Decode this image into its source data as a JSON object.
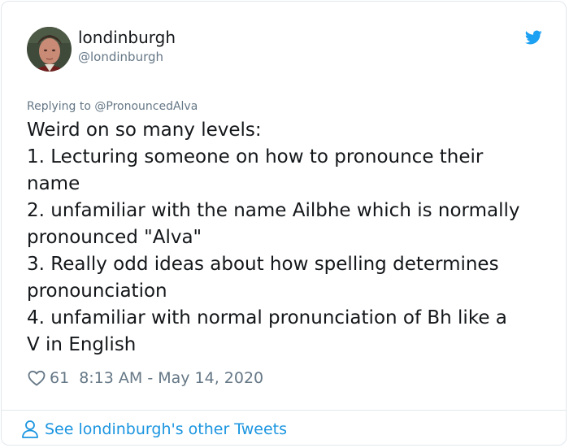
{
  "tweet": {
    "author": {
      "display_name": "londinburgh",
      "handle": "@londinburgh",
      "avatar_icon": "avatar"
    },
    "platform_icon": "twitter-bird-icon",
    "reply_to": "Replying to @PronouncedAlva",
    "text_lines": [
      "Weird on so many levels:",
      "1. Lecturing someone on how to pronounce their",
      "name",
      "2. unfamiliar with the name Ailbhe which is normally",
      "pronounced \"Alva\"",
      "3. Really odd ideas about how spelling determines",
      "pronounciation",
      "4. unfamiliar with normal pronunciation of Bh like a",
      "V in English"
    ],
    "like_icon": "heart-icon",
    "likes": "61",
    "timestamp": "8:13 AM - May 14, 2020"
  },
  "footer": {
    "icon": "person-icon",
    "link_text": "See londinburgh's other Tweets"
  },
  "colors": {
    "text": "#14171a",
    "secondary": "#657786",
    "link": "#1b95e0",
    "twitter_blue": "#1da1f2",
    "border": "#e1e8ed"
  }
}
